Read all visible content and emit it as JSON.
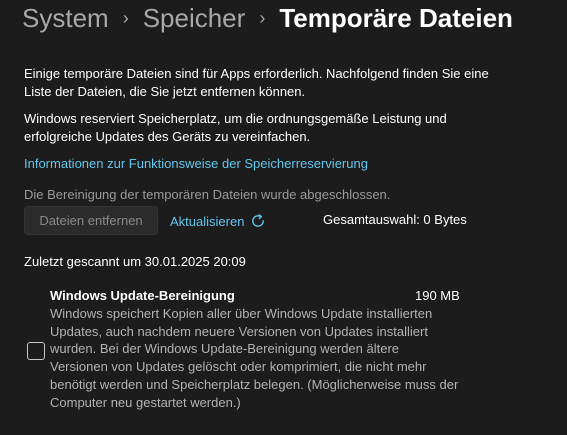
{
  "breadcrumb": {
    "items": [
      "System",
      "Speicher"
    ],
    "separator": "›",
    "current": "Temporäre Dateien"
  },
  "intro": {
    "paragraph1": "Einige temporäre Dateien sind für Apps erforderlich. Nachfolgend finden Sie eine Liste der Dateien, die Sie jetzt entfernen können.",
    "paragraph2": "Windows reserviert Speicherplatz, um die ordnungsgemäße Leistung und erfolgreiche Updates des Geräts zu vereinfachen."
  },
  "reservation_link": "Informationen zur Funktionsweise der Speicherreservierung",
  "cleanup_status": "Die Bereinigung der temporären Dateien wurde abgeschlossen.",
  "actions": {
    "remove_label": "Dateien entfernen",
    "remove_enabled": false,
    "refresh_label": "Aktualisieren",
    "refresh_icon": "refresh-icon"
  },
  "total_selection": "Gesamtauswahl: 0 Bytes",
  "last_scanned": "Zuletzt gescannt um 30.01.2025 20:09",
  "items": [
    {
      "title": "Windows Update-Bereinigung",
      "size": "190 MB",
      "checked": false,
      "description": "Windows speichert Kopien aller über Windows Update installierten Updates, auch nachdem neuere Versionen von Updates installiert wurden. Bei der Windows Update-Bereinigung werden ältere Versionen von Updates gelöscht oder komprimiert, die nicht mehr benötigt werden und Speicherplatz belegen. (Möglicherweise muss der Computer neu gestartet werden.)"
    }
  ],
  "colors": {
    "background": "#1c1c1c",
    "accent": "#5ec8ee",
    "muted_text": "#9a9a9a"
  }
}
